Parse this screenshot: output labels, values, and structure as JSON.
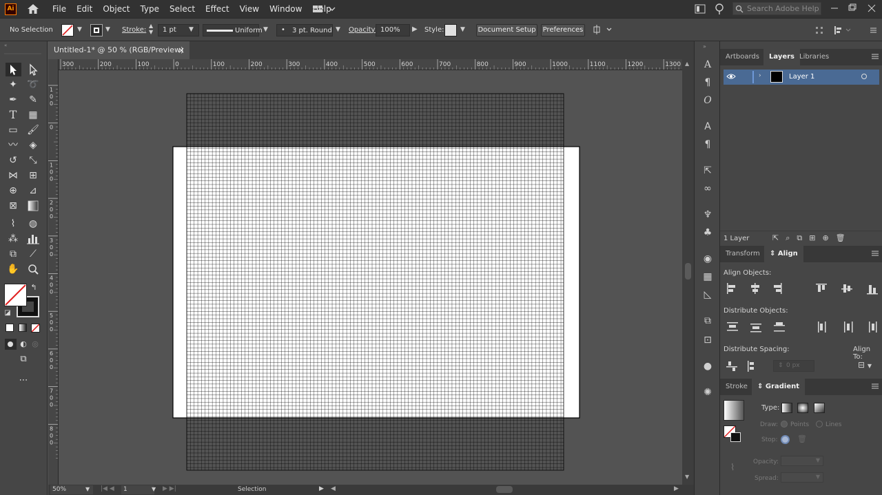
{
  "app": {
    "logo": "Ai"
  },
  "menu": [
    "File",
    "Edit",
    "Object",
    "Type",
    "Select",
    "Effect",
    "View",
    "Window",
    "Help"
  ],
  "search": {
    "placeholder": "Search Adobe Help"
  },
  "control": {
    "selection_label": "No Selection",
    "stroke_label": "Stroke:",
    "stroke_value": "1 pt",
    "profile_label": "Uniform",
    "brush_label": "3 pt. Round",
    "opacity_label": "Opacity:",
    "opacity_value": "100%",
    "style_label": "Style:",
    "document_setup": "Document Setup",
    "preferences": "Preferences"
  },
  "document": {
    "tab_title": "Untitled-1* @ 50 % (RGB/Preview)",
    "close": "×",
    "ruler_h": [
      "300",
      "200",
      "100",
      "0",
      "100",
      "200",
      "300",
      "400",
      "500",
      "600",
      "700",
      "800",
      "900",
      "1000",
      "1100",
      "1200",
      "1300"
    ],
    "ruler_v": [
      [
        "1",
        "0",
        "0"
      ],
      [
        "0"
      ],
      [
        "1",
        "0",
        "0"
      ],
      [
        "2",
        "0",
        "0"
      ],
      [
        "3",
        "0",
        "0"
      ],
      [
        "4",
        "0",
        "0"
      ],
      [
        "5",
        "0",
        "0"
      ],
      [
        "6",
        "0",
        "0"
      ],
      [
        "7",
        "0",
        "0"
      ],
      [
        "8",
        "0",
        "0"
      ]
    ]
  },
  "status": {
    "zoom": "50%",
    "artboard": "1",
    "mode": "Selection"
  },
  "layers_panel": {
    "tabs": [
      "Artboards",
      "Layers",
      "Libraries"
    ],
    "active_tab": "Layers",
    "layer_name": "Layer 1",
    "count": "1 Layer"
  },
  "align_panel": {
    "tabs": [
      "Transform",
      "Align"
    ],
    "active_tab": "Align",
    "align_objects": "Align Objects:",
    "distribute_objects": "Distribute Objects:",
    "distribute_spacing": "Distribute Spacing:",
    "align_to": "Align To:",
    "spacing_value": "0 px"
  },
  "gradient_panel": {
    "tabs": [
      "Stroke",
      "Gradient"
    ],
    "active_tab": "Gradient",
    "type_label": "Type:",
    "draw_label": "Draw:",
    "points_label": "Points",
    "lines_label": "Lines",
    "stop_label": "Stop:",
    "opacity_label": "Opacity:",
    "spread_label": "Spread:"
  },
  "colors": {
    "artboard": "#ffffff",
    "grid_line": "#000000",
    "selection_accent": "#4a6a94",
    "canvas": "#535353"
  }
}
